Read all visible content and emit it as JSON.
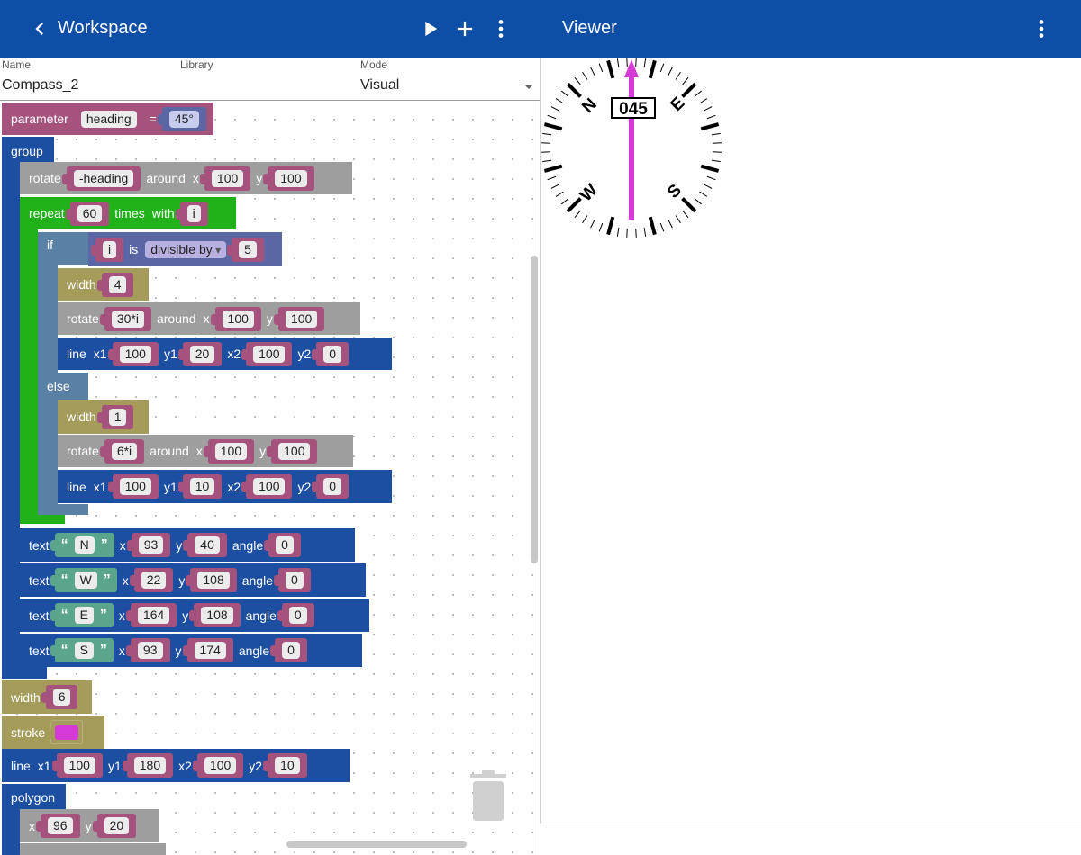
{
  "workspace_bar": {
    "title": "Workspace",
    "icons": [
      "chevron-left-icon",
      "play-icon",
      "plus-icon",
      "more-vert-icon"
    ]
  },
  "viewer_bar": {
    "title": "Viewer",
    "icons": [
      "more-vert-icon"
    ]
  },
  "form": {
    "name_label": "Name",
    "name_value": "Compass_2",
    "library_label": "Library",
    "mode_label": "Mode",
    "mode_value": "Visual"
  },
  "blocks": {
    "parameter": {
      "kw": "parameter",
      "name": "heading",
      "eq": "=",
      "value": "45°"
    },
    "group": {
      "kw": "group"
    },
    "rotate_heading": {
      "kw": "rotate",
      "angle": "-heading",
      "around": "around",
      "x": "x",
      "xv": "100",
      "y": "y",
      "yv": "100"
    },
    "repeat": {
      "kw": "repeat",
      "count": "60",
      "times": "times",
      "with": "with",
      "var": "i"
    },
    "if": {
      "kw": "if",
      "var": "i",
      "is": "is",
      "op": "divisible by",
      "num": "5",
      "else": "else"
    },
    "width_4": {
      "kw": "width",
      "v": "4"
    },
    "rotate_30": {
      "kw": "rotate",
      "angle": "30*i",
      "around": "around",
      "x": "x",
      "xv": "100",
      "y": "y",
      "yv": "100"
    },
    "line_major": {
      "kw": "line",
      "x1": "x1",
      "x1v": "100",
      "y1": "y1",
      "y1v": "20",
      "x2": "x2",
      "x2v": "100",
      "y2": "y2",
      "y2v": "0"
    },
    "width_1": {
      "kw": "width",
      "v": "1"
    },
    "rotate_6": {
      "kw": "rotate",
      "angle": "6*i",
      "around": "around",
      "x": "x",
      "xv": "100",
      "y": "y",
      "yv": "100"
    },
    "line_minor": {
      "kw": "line",
      "x1": "x1",
      "x1v": "100",
      "y1": "y1",
      "y1v": "10",
      "x2": "x2",
      "x2v": "100",
      "y2": "y2",
      "y2v": "0"
    },
    "text_n": {
      "kw": "text",
      "s": "N",
      "x": "x",
      "xv": "93",
      "y": "y",
      "yv": "40",
      "angle": "angle",
      "av": "0"
    },
    "text_w": {
      "kw": "text",
      "s": "W",
      "x": "x",
      "xv": "22",
      "y": "y",
      "yv": "108",
      "angle": "angle",
      "av": "0"
    },
    "text_e": {
      "kw": "text",
      "s": "E",
      "x": "x",
      "xv": "164",
      "y": "y",
      "yv": "108",
      "angle": "angle",
      "av": "0"
    },
    "text_s": {
      "kw": "text",
      "s": "S",
      "x": "x",
      "xv": "93",
      "y": "y",
      "yv": "174",
      "angle": "angle",
      "av": "0"
    },
    "width_6": {
      "kw": "width",
      "v": "6"
    },
    "stroke": {
      "kw": "stroke",
      "color": "#d63ad6"
    },
    "line_needle": {
      "kw": "line",
      "x1": "x1",
      "x1v": "100",
      "y1": "y1",
      "y1v": "180",
      "x2": "x2",
      "x2v": "100",
      "y2": "y2",
      "y2v": "10"
    },
    "polygon": {
      "kw": "polygon"
    },
    "point_1": {
      "x": "x",
      "xv": "96",
      "y": "y",
      "yv": "20"
    }
  },
  "compass": {
    "heading_readout": "045",
    "letters": [
      "N",
      "E",
      "S",
      "W"
    ],
    "needle_color": "#d63ad6",
    "heading_deg": 45
  },
  "colors": {
    "appbar": "#0d4ea6",
    "block_blue": "#1c4ea2",
    "block_green": "#21b21a",
    "block_pink": "#a5537d",
    "block_olive": "#a59b5b",
    "block_gray": "#9e9e9e",
    "block_if": "#5b80a5"
  }
}
